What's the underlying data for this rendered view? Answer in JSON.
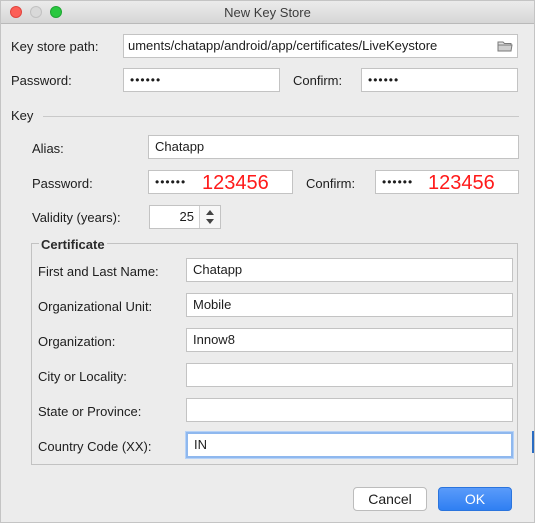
{
  "window": {
    "title": "New Key Store"
  },
  "keystore": {
    "path_label": "Key store path:",
    "path_value": "uments/chatapp/android/app/certificates/LiveKeystore",
    "password_label": "Password:",
    "password_value": "••••••",
    "confirm_label": "Confirm:",
    "confirm_value": "••••••"
  },
  "key": {
    "section_label": "Key",
    "alias_label": "Alias:",
    "alias_value": "Chatapp",
    "password_label": "Password:",
    "password_value": "••••••",
    "password_annotation": "123456",
    "confirm_label": "Confirm:",
    "confirm_value": "••••••",
    "confirm_annotation": "123456",
    "validity_label": "Validity (years):",
    "validity_value": "25"
  },
  "certificate": {
    "section_label": "Certificate",
    "name_label": "First and Last Name:",
    "name_value": "Chatapp",
    "org_unit_label": "Organizational Unit:",
    "org_unit_value": "Mobile",
    "org_label": "Organization:",
    "org_value": "Innow8",
    "city_label": "City or Locality:",
    "city_value": "",
    "state_label": "State or Province:",
    "state_value": "",
    "country_label": "Country Code (XX):",
    "country_value": "IN"
  },
  "buttons": {
    "cancel": "Cancel",
    "ok": "OK"
  },
  "colors": {
    "annotation_red": "#ff1a1a",
    "ok_blue": "#2f7ff2"
  },
  "icons": {
    "browse": "folder-icon"
  }
}
